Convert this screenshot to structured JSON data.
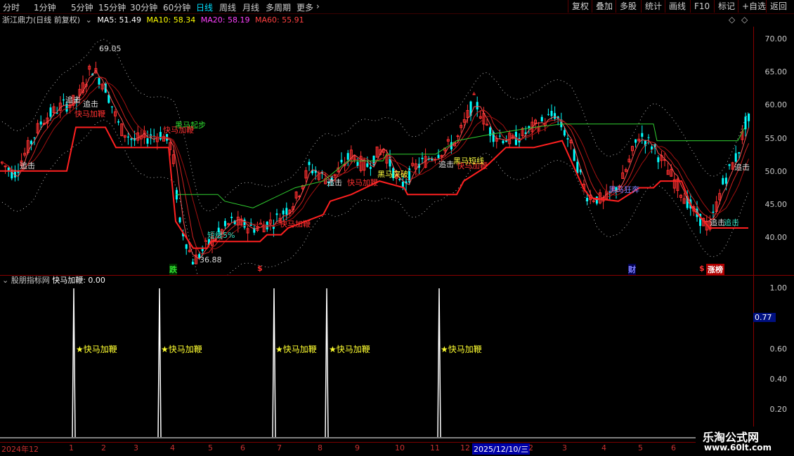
{
  "toolbar": {
    "timeframes": [
      "分时",
      "1分钟",
      "5分钟",
      "15分钟",
      "30分钟",
      "60分钟",
      "日线",
      "周线",
      "月线",
      "多周期",
      "更多"
    ],
    "active_timeframe": "日线",
    "right_buttons": [
      "复权",
      "叠加",
      "多股",
      "统计",
      "画线",
      "F10",
      "标记",
      "+自选",
      "返回"
    ]
  },
  "header": {
    "stock": "浙江鼎力(日线 前复权)",
    "ma5_label": "MA5: 51.49",
    "ma10_label": "MA10: 58.34",
    "ma20_label": "MA20: 58.19",
    "ma60_label": "MA60: 55.91"
  },
  "colors": {
    "up": "#ff3030",
    "down": "#00ffff",
    "ma5": "#ffffff",
    "ma10": "#ffff00",
    "ma20": "#ff00ff",
    "red_line": "#ff2020",
    "green_line": "#30d030",
    "axis": "#8a0000"
  },
  "price_axis": [
    "70.00",
    "65.00",
    "60.00",
    "55.00",
    "50.00",
    "45.00",
    "40.00"
  ],
  "price_range": [
    36,
    73
  ],
  "annotations": {
    "high": "69.05",
    "low": "36.88",
    "labels": [
      "追击",
      "追击",
      "追击",
      "快马加鞭",
      "黑马起步",
      "快马加鞭",
      "短线5%",
      "追击",
      "快马加鞭",
      "快马加鞭",
      "黑马突破",
      "追击",
      "快马加鞭",
      "黑马短线",
      "追击",
      "黑马狂奔",
      "追击",
      "追击"
    ]
  },
  "event_marks": {
    "die": "跌",
    "s1": "$",
    "cai": "财",
    "s2": "$",
    "zhang": "涨榜"
  },
  "indicator": {
    "title": "股朋指标网",
    "name_value": "快马加鞭: 0.00",
    "axis": [
      "1.00",
      "0.60",
      "0.40",
      "0.20"
    ],
    "current": "0.77",
    "signal_label": "★快马加鞭",
    "signals": [
      1,
      1,
      1,
      1,
      1
    ]
  },
  "date_axis": [
    "2024年12",
    "1",
    "2",
    "3",
    "4",
    "5",
    "6",
    "7",
    "8",
    "9",
    "10",
    "11",
    "12",
    "2025/12/10/三",
    "2",
    "3",
    "4",
    "5",
    "6"
  ],
  "watermark": {
    "name": "乐淘公式网",
    "url": "www.60lt.com"
  }
}
